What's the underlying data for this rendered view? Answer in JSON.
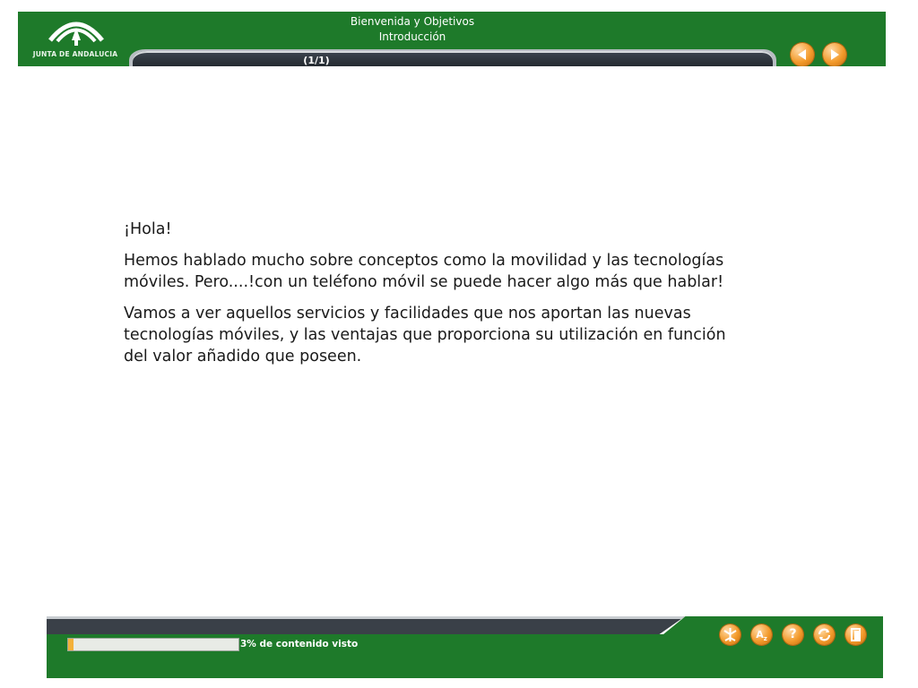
{
  "header": {
    "logo_text": "JUNTA DE ANDALUCIA",
    "title": "Bienvenida y Objetivos",
    "subtitle": "Introducción",
    "page_counter": "(1/1)",
    "prev_icon": "arrow-left-icon",
    "next_icon": "arrow-right-icon"
  },
  "content": {
    "paragraphs": [
      "¡Hola!",
      "Hemos hablado mucho sobre conceptos como la movilidad y las tecnologías móviles. Pero....!con un teléfono móvil se puede hacer algo más que hablar!",
      "Vamos a ver aquellos servicios y facilidades que nos aportan las nuevas tecnologías móviles, y las ventajas que proporciona su utilización en función del valor añadido que poseen."
    ]
  },
  "footer": {
    "progress_percent": 3,
    "progress_label": "3% de contenido visto",
    "tools": [
      "map-icon",
      "glossary-az-icon",
      "help-icon",
      "refresh-icon",
      "exit-icon"
    ]
  },
  "colors": {
    "green": "#1e7a2a",
    "dark_band": "#3a4048",
    "orange_button": "#f39a2b",
    "progress_fill": "#f3b13a"
  }
}
